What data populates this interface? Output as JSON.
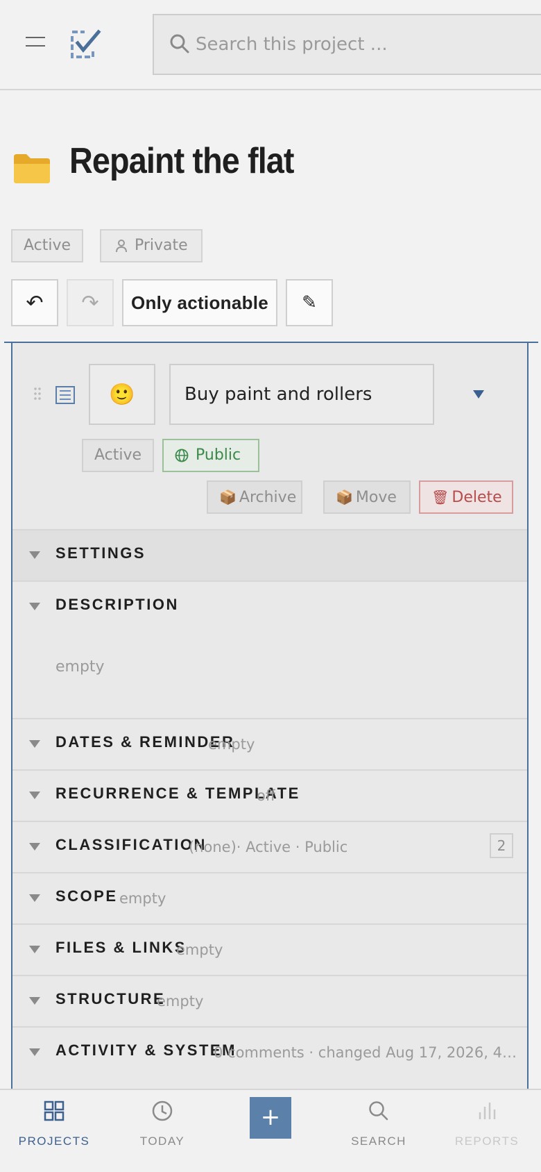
{
  "header": {
    "search_placeholder": "Search this project ...",
    "menu_icon": "hamburger-icon",
    "logo_icon": "checkbox-logo-icon"
  },
  "project": {
    "icon": "📁",
    "title": "Repaint the flat",
    "status": "Active",
    "visibility": "Private"
  },
  "toolbar": {
    "undo_label": "↶",
    "redo_label": "↷",
    "filter_label": "Only actionable",
    "edit_label": "✎"
  },
  "task": {
    "emoji": "🙂",
    "title": "Buy paint and rollers",
    "status": "Active",
    "visibility": "Public",
    "actions": {
      "archive_icon": "📦",
      "archive": "Archive",
      "move_icon": "📦",
      "move": "Move",
      "delete_icon": "🗑",
      "delete": "Delete"
    },
    "sections": {
      "settings": {
        "label": "SETTINGS"
      },
      "description": {
        "label": "DESCRIPTION",
        "value": "empty"
      },
      "dates": {
        "label": "DATES & REMINDER",
        "value": "empty"
      },
      "recurrence": {
        "label": "RECURRENCE & TEMPLATE",
        "value": "off"
      },
      "classification": {
        "label": "CLASSIFICATION",
        "value": "(none)· Active · Public",
        "count": "2"
      },
      "scope": {
        "label": "SCOPE",
        "value": "empty"
      },
      "files": {
        "label": "FILES & LINKS",
        "value": "empty"
      },
      "structure": {
        "label": "STRUCTURE",
        "value": "empty"
      },
      "activity": {
        "label": "ACTIVITY & SYSTEM",
        "value": "0 comments · changed Aug 17, 2026, 4…"
      }
    }
  },
  "bottom_nav": {
    "projects": "PROJECTS",
    "today": "TODAY",
    "add": "+",
    "search": "SEARCH",
    "reports": "REPORTS"
  },
  "colors": {
    "accent": "#4a6f99",
    "public_green": "#3b8a4a",
    "delete_red": "#b74c4c",
    "background": "#f3f2f3"
  }
}
